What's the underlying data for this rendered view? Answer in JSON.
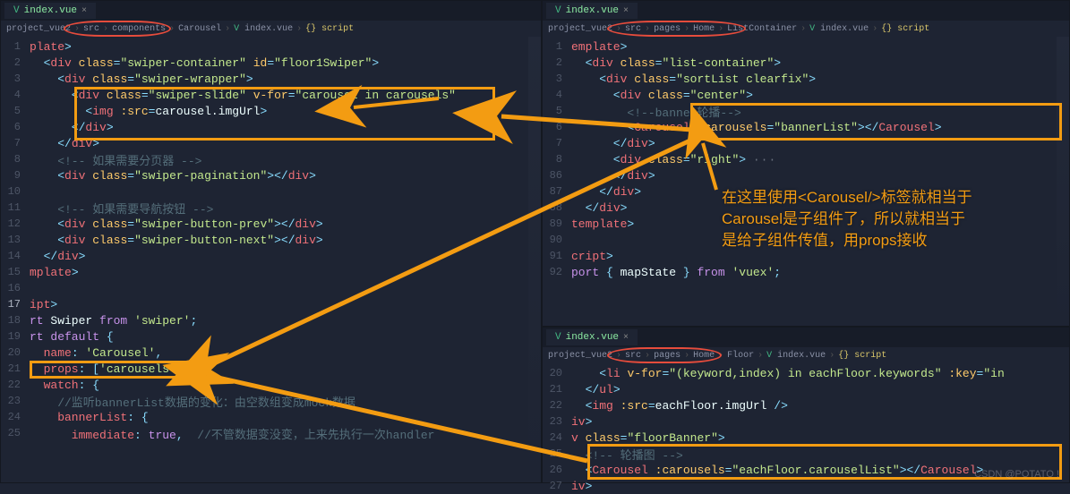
{
  "left": {
    "tab": "index.vue",
    "breadcrumb": [
      "project_vue2",
      "src",
      "components",
      "Carousel",
      "index.vue",
      "{} script"
    ],
    "lines": [
      {
        "n": 1,
        "frags": [
          {
            "c": "tag",
            "t": "plate"
          },
          {
            "c": "punc",
            "t": ">"
          }
        ]
      },
      {
        "n": 2,
        "frags": [
          {
            "c": "punc",
            "t": "  <"
          },
          {
            "c": "tag",
            "t": "div"
          },
          {
            "c": "",
            "t": " "
          },
          {
            "c": "attr",
            "t": "class"
          },
          {
            "c": "punc",
            "t": "="
          },
          {
            "c": "str",
            "t": "\"swiper-container\""
          },
          {
            "c": "",
            "t": " "
          },
          {
            "c": "attr",
            "t": "id"
          },
          {
            "c": "punc",
            "t": "="
          },
          {
            "c": "str",
            "t": "\"floor1Swiper\""
          },
          {
            "c": "punc",
            "t": ">"
          }
        ]
      },
      {
        "n": 3,
        "frags": [
          {
            "c": "punc",
            "t": "    <"
          },
          {
            "c": "tag",
            "t": "div"
          },
          {
            "c": "",
            "t": " "
          },
          {
            "c": "attr",
            "t": "class"
          },
          {
            "c": "punc",
            "t": "="
          },
          {
            "c": "str",
            "t": "\"swiper-wrapper\""
          },
          {
            "c": "punc",
            "t": ">"
          }
        ]
      },
      {
        "n": 4,
        "frags": [
          {
            "c": "punc",
            "t": "      <"
          },
          {
            "c": "tag",
            "t": "div"
          },
          {
            "c": "",
            "t": " "
          },
          {
            "c": "attr",
            "t": "class"
          },
          {
            "c": "punc",
            "t": "="
          },
          {
            "c": "str",
            "t": "\"swiper-slide\""
          },
          {
            "c": "",
            "t": " "
          },
          {
            "c": "attr",
            "t": "v-for"
          },
          {
            "c": "punc",
            "t": "="
          },
          {
            "c": "str",
            "t": "\"carousel in carousels\""
          }
        ]
      },
      {
        "n": 5,
        "frags": [
          {
            "c": "punc",
            "t": "        <"
          },
          {
            "c": "tag",
            "t": "img"
          },
          {
            "c": "",
            "t": " "
          },
          {
            "c": "attr",
            "t": ":src"
          },
          {
            "c": "punc",
            "t": "="
          },
          {
            "c": "ident",
            "t": "carousel.imgUrl"
          },
          {
            "c": "punc",
            "t": ">"
          }
        ]
      },
      {
        "n": 6,
        "frags": [
          {
            "c": "punc",
            "t": "      </"
          },
          {
            "c": "tag",
            "t": "div"
          },
          {
            "c": "punc",
            "t": ">"
          }
        ]
      },
      {
        "n": 7,
        "frags": [
          {
            "c": "punc",
            "t": "    </"
          },
          {
            "c": "tag",
            "t": "div"
          },
          {
            "c": "punc",
            "t": ">"
          }
        ]
      },
      {
        "n": 8,
        "frags": [
          {
            "c": "cmt",
            "t": "    <!-- 如果需要分页器 -->"
          }
        ]
      },
      {
        "n": 9,
        "frags": [
          {
            "c": "punc",
            "t": "    <"
          },
          {
            "c": "tag",
            "t": "div"
          },
          {
            "c": "",
            "t": " "
          },
          {
            "c": "attr",
            "t": "class"
          },
          {
            "c": "punc",
            "t": "="
          },
          {
            "c": "str",
            "t": "\"swiper-pagination\""
          },
          {
            "c": "punc",
            "t": "></"
          },
          {
            "c": "tag",
            "t": "div"
          },
          {
            "c": "punc",
            "t": ">"
          }
        ]
      },
      {
        "n": 10,
        "frags": []
      },
      {
        "n": 11,
        "frags": [
          {
            "c": "cmt",
            "t": "    <!-- 如果需要导航按钮 -->"
          }
        ]
      },
      {
        "n": 12,
        "frags": [
          {
            "c": "punc",
            "t": "    <"
          },
          {
            "c": "tag",
            "t": "div"
          },
          {
            "c": "",
            "t": " "
          },
          {
            "c": "attr",
            "t": "class"
          },
          {
            "c": "punc",
            "t": "="
          },
          {
            "c": "str",
            "t": "\"swiper-button-prev\""
          },
          {
            "c": "punc",
            "t": "></"
          },
          {
            "c": "tag",
            "t": "div"
          },
          {
            "c": "punc",
            "t": ">"
          }
        ]
      },
      {
        "n": 13,
        "frags": [
          {
            "c": "punc",
            "t": "    <"
          },
          {
            "c": "tag",
            "t": "div"
          },
          {
            "c": "",
            "t": " "
          },
          {
            "c": "attr",
            "t": "class"
          },
          {
            "c": "punc",
            "t": "="
          },
          {
            "c": "str",
            "t": "\"swiper-button-next\""
          },
          {
            "c": "punc",
            "t": "></"
          },
          {
            "c": "tag",
            "t": "div"
          },
          {
            "c": "punc",
            "t": ">"
          }
        ]
      },
      {
        "n": 14,
        "frags": [
          {
            "c": "punc",
            "t": "  </"
          },
          {
            "c": "tag",
            "t": "div"
          },
          {
            "c": "punc",
            "t": ">"
          }
        ]
      },
      {
        "n": 15,
        "frags": [
          {
            "c": "tag",
            "t": "mplate"
          },
          {
            "c": "punc",
            "t": ">"
          }
        ]
      },
      {
        "n": 16,
        "frags": []
      },
      {
        "n": 17,
        "frags": [
          {
            "c": "tag",
            "t": "ipt"
          },
          {
            "c": "punc",
            "t": ">"
          }
        ],
        "active": true
      },
      {
        "n": 18,
        "frags": [
          {
            "c": "kw",
            "t": "rt "
          },
          {
            "c": "ident",
            "t": "Swiper"
          },
          {
            "c": "kw",
            "t": " from "
          },
          {
            "c": "str",
            "t": "'swiper'"
          },
          {
            "c": "punc",
            "t": ";"
          }
        ]
      },
      {
        "n": 19,
        "frags": [
          {
            "c": "kw",
            "t": "rt default "
          },
          {
            "c": "punc",
            "t": "{"
          }
        ]
      },
      {
        "n": 20,
        "frags": [
          {
            "c": "prop",
            "t": "  name"
          },
          {
            "c": "punc",
            "t": ": "
          },
          {
            "c": "str",
            "t": "'Carousel'"
          },
          {
            "c": "punc",
            "t": ","
          }
        ]
      },
      {
        "n": 21,
        "frags": [
          {
            "c": "prop",
            "t": "  props"
          },
          {
            "c": "punc",
            "t": ": ["
          },
          {
            "c": "str",
            "t": "'carousels'"
          },
          {
            "c": "punc",
            "t": "],"
          }
        ]
      },
      {
        "n": 22,
        "frags": [
          {
            "c": "prop",
            "t": "  watch"
          },
          {
            "c": "punc",
            "t": ": {"
          }
        ]
      },
      {
        "n": 23,
        "frags": [
          {
            "c": "cmt",
            "t": "    //监听bannerList数据的变化：由空数组变成mock数据"
          }
        ]
      },
      {
        "n": 24,
        "frags": [
          {
            "c": "prop",
            "t": "    bannerList"
          },
          {
            "c": "punc",
            "t": ": {"
          }
        ]
      },
      {
        "n": 25,
        "frags": [
          {
            "c": "prop",
            "t": "      immediate"
          },
          {
            "c": "punc",
            "t": ": "
          },
          {
            "c": "kw",
            "t": "true"
          },
          {
            "c": "punc",
            "t": ",  "
          },
          {
            "c": "cmt",
            "t": "//不管数据变没变，上来先执行一次handler"
          }
        ]
      }
    ]
  },
  "topRight": {
    "tab": "index.vue",
    "breadcrumb": [
      "project_vue2",
      "src",
      "pages",
      "Home",
      "ListContainer",
      "index.vue",
      "{} script"
    ],
    "lines": [
      {
        "n": 1,
        "frags": [
          {
            "c": "tag",
            "t": "emplate"
          },
          {
            "c": "punc",
            "t": ">"
          }
        ]
      },
      {
        "n": 2,
        "frags": [
          {
            "c": "punc",
            "t": "  <"
          },
          {
            "c": "tag",
            "t": "div"
          },
          {
            "c": "",
            "t": " "
          },
          {
            "c": "attr",
            "t": "class"
          },
          {
            "c": "punc",
            "t": "="
          },
          {
            "c": "str",
            "t": "\"list-container\""
          },
          {
            "c": "punc",
            "t": ">"
          }
        ]
      },
      {
        "n": 3,
        "frags": [
          {
            "c": "punc",
            "t": "    <"
          },
          {
            "c": "tag",
            "t": "div"
          },
          {
            "c": "",
            "t": " "
          },
          {
            "c": "attr",
            "t": "class"
          },
          {
            "c": "punc",
            "t": "="
          },
          {
            "c": "str",
            "t": "\"sortList clearfix\""
          },
          {
            "c": "punc",
            "t": ">"
          }
        ]
      },
      {
        "n": 4,
        "frags": [
          {
            "c": "punc",
            "t": "      <"
          },
          {
            "c": "tag",
            "t": "div"
          },
          {
            "c": "",
            "t": " "
          },
          {
            "c": "attr",
            "t": "class"
          },
          {
            "c": "punc",
            "t": "="
          },
          {
            "c": "str",
            "t": "\"center\""
          },
          {
            "c": "punc",
            "t": ">"
          }
        ]
      },
      {
        "n": 5,
        "frags": [
          {
            "c": "cmt",
            "t": "        <!--banner轮播-->"
          }
        ]
      },
      {
        "n": 6,
        "frags": [
          {
            "c": "punc",
            "t": "        <"
          },
          {
            "c": "tag",
            "t": "Carousel"
          },
          {
            "c": "",
            "t": " "
          },
          {
            "c": "attr",
            "t": ":carousels"
          },
          {
            "c": "punc",
            "t": "="
          },
          {
            "c": "str",
            "t": "\"bannerList\""
          },
          {
            "c": "punc",
            "t": "></"
          },
          {
            "c": "tag",
            "t": "Carousel"
          },
          {
            "c": "punc",
            "t": ">"
          }
        ]
      },
      {
        "n": 7,
        "frags": [
          {
            "c": "punc",
            "t": "      </"
          },
          {
            "c": "tag",
            "t": "div"
          },
          {
            "c": "punc",
            "t": ">"
          }
        ]
      },
      {
        "n": 8,
        "frags": [
          {
            "c": "punc",
            "t": "      <"
          },
          {
            "c": "tag",
            "t": "div"
          },
          {
            "c": "",
            "t": " "
          },
          {
            "c": "attr",
            "t": "class"
          },
          {
            "c": "punc",
            "t": "="
          },
          {
            "c": "str",
            "t": "\"right\""
          },
          {
            "c": "punc",
            "t": "> "
          },
          {
            "c": "dots",
            "t": "···"
          }
        ]
      },
      {
        "n": 86,
        "frags": [
          {
            "c": "punc",
            "t": "      </"
          },
          {
            "c": "tag",
            "t": "div"
          },
          {
            "c": "punc",
            "t": ">"
          }
        ]
      },
      {
        "n": 87,
        "frags": [
          {
            "c": "punc",
            "t": "    </"
          },
          {
            "c": "tag",
            "t": "div"
          },
          {
            "c": "punc",
            "t": ">"
          }
        ]
      },
      {
        "n": 88,
        "frags": [
          {
            "c": "punc",
            "t": "  </"
          },
          {
            "c": "tag",
            "t": "div"
          },
          {
            "c": "punc",
            "t": ">"
          }
        ]
      },
      {
        "n": 89,
        "frags": [
          {
            "c": "tag",
            "t": "template"
          },
          {
            "c": "punc",
            "t": ">"
          }
        ]
      },
      {
        "n": 90,
        "frags": []
      },
      {
        "n": 91,
        "frags": [
          {
            "c": "tag",
            "t": "cript"
          },
          {
            "c": "punc",
            "t": ">"
          }
        ]
      },
      {
        "n": 92,
        "frags": [
          {
            "c": "kw",
            "t": "port "
          },
          {
            "c": "punc",
            "t": "{ "
          },
          {
            "c": "ident",
            "t": "mapState"
          },
          {
            "c": "punc",
            "t": " } "
          },
          {
            "c": "kw",
            "t": "from "
          },
          {
            "c": "str",
            "t": "'vuex'"
          },
          {
            "c": "punc",
            "t": ";"
          }
        ]
      }
    ],
    "annotation": [
      "在这里使用<Carousel/>标签就相当于",
      "Carousel是子组件了，所以就相当于",
      "是给子组件传值，用props接收"
    ]
  },
  "botRight": {
    "tab": "index.vue",
    "breadcrumb": [
      "project_vue2",
      "src",
      "pages",
      "Home",
      "Floor",
      "index.vue",
      "{} script"
    ],
    "lines": [
      {
        "n": 20,
        "frags": [
          {
            "c": "punc",
            "t": "    <"
          },
          {
            "c": "tag",
            "t": "li"
          },
          {
            "c": "",
            "t": " "
          },
          {
            "c": "attr",
            "t": "v-for"
          },
          {
            "c": "punc",
            "t": "="
          },
          {
            "c": "str",
            "t": "\"(keyword,index) in eachFloor.keywords\""
          },
          {
            "c": "",
            "t": " "
          },
          {
            "c": "attr",
            "t": ":key"
          },
          {
            "c": "punc",
            "t": "="
          },
          {
            "c": "str",
            "t": "\"in"
          }
        ]
      },
      {
        "n": 21,
        "frags": [
          {
            "c": "punc",
            "t": "  </"
          },
          {
            "c": "tag",
            "t": "ul"
          },
          {
            "c": "punc",
            "t": ">"
          }
        ]
      },
      {
        "n": 22,
        "frags": [
          {
            "c": "punc",
            "t": "  <"
          },
          {
            "c": "tag",
            "t": "img"
          },
          {
            "c": "",
            "t": " "
          },
          {
            "c": "attr",
            "t": ":src"
          },
          {
            "c": "punc",
            "t": "="
          },
          {
            "c": "ident",
            "t": "eachFloor.imgUrl"
          },
          {
            "c": "punc",
            "t": " />"
          }
        ]
      },
      {
        "n": 23,
        "frags": [
          {
            "c": "tag",
            "t": "iv"
          },
          {
            "c": "punc",
            "t": ">"
          }
        ]
      },
      {
        "n": 24,
        "frags": [
          {
            "c": "tag",
            "t": "v"
          },
          {
            "c": "",
            "t": " "
          },
          {
            "c": "attr",
            "t": "class"
          },
          {
            "c": "punc",
            "t": "="
          },
          {
            "c": "str",
            "t": "\"floorBanner\""
          },
          {
            "c": "punc",
            "t": ">"
          }
        ]
      },
      {
        "n": 25,
        "frags": [
          {
            "c": "cmt",
            "t": "  <!-- 轮播图 -->"
          }
        ]
      },
      {
        "n": 26,
        "frags": [
          {
            "c": "punc",
            "t": "  <"
          },
          {
            "c": "tag",
            "t": "Carousel"
          },
          {
            "c": "",
            "t": " "
          },
          {
            "c": "attr",
            "t": ":carousels"
          },
          {
            "c": "punc",
            "t": "="
          },
          {
            "c": "str",
            "t": "\"eachFloor.carouselList\""
          },
          {
            "c": "punc",
            "t": "></"
          },
          {
            "c": "tag",
            "t": "Carousel"
          },
          {
            "c": "punc",
            "t": ">"
          }
        ]
      },
      {
        "n": 27,
        "frags": [
          {
            "c": "tag",
            "t": "iv"
          },
          {
            "c": "punc",
            "t": ">"
          }
        ]
      }
    ]
  },
  "watermark": "CSDN @POTATO !"
}
